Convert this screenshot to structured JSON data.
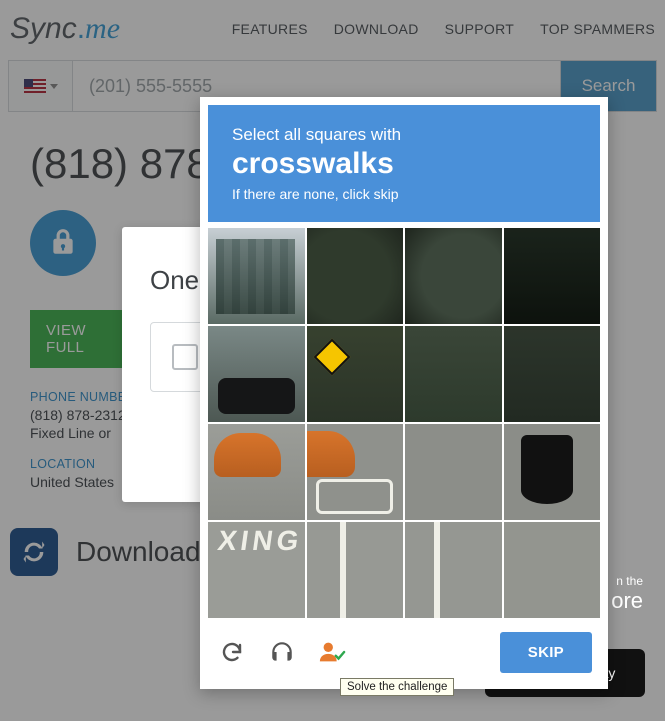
{
  "header": {
    "logo_sync": "Sync",
    "logo_dot": ".",
    "logo_me": "me",
    "nav": [
      "FEATURES",
      "DOWNLOAD",
      "SUPPORT",
      "TOP SPAMMERS"
    ]
  },
  "search": {
    "placeholder": "(201) 555-5555",
    "button": "Search",
    "country": "US"
  },
  "result": {
    "title_partial": "(818) 878-",
    "view_button_partial": "VIEW FULL",
    "phone_label": "PHONE NUMBER",
    "phone_value_partial": "(818) 878-2312",
    "type_line_partial": "Fixed Line or ",
    "location_label": "LOCATION",
    "location_value": "United States"
  },
  "midcard": {
    "title_partial": "One"
  },
  "download": {
    "text_partial": "Download  S",
    "appstore_line1_partial": "n the",
    "appstore_line2_partial": "ore",
    "googleplay_partial": "Google play"
  },
  "captcha": {
    "lead": "Select all squares with",
    "target": "crosswalks",
    "sub": "If there are none, click skip",
    "skip": "SKIP",
    "tooltip": "Solve the challenge",
    "icons": {
      "reload": "reload-icon",
      "audio": "audio-icon",
      "help": "help-icon"
    }
  },
  "colors": {
    "accent_blue": "#4a90d9",
    "brand_blue": "#359bd6",
    "green": "#3bb149",
    "orange": "#e77b2f"
  }
}
